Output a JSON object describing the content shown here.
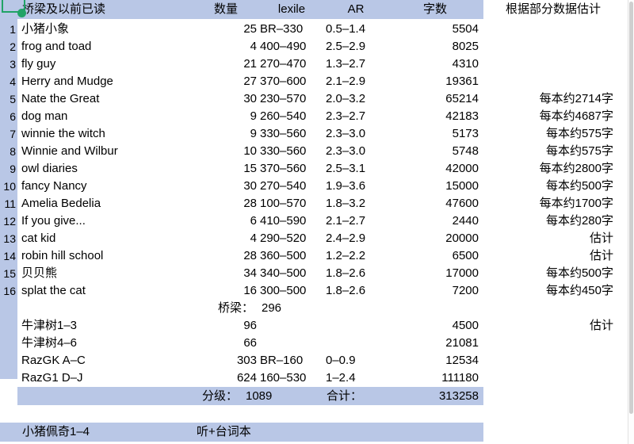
{
  "table": {
    "headers": {
      "gutter": "",
      "title": "桥梁及以前已读",
      "qty": "数量",
      "lexile": "lexile",
      "ar": "AR",
      "words": "字数",
      "note": "根据部分数据估计"
    },
    "rows": [
      {
        "num": "1",
        "title": "小猪小象",
        "qty": "25",
        "lexile": "BR–330",
        "ar": "0.5–1.4",
        "words": "5504",
        "note": ""
      },
      {
        "num": "2",
        "title": "frog and toad",
        "qty": "4",
        "lexile": "400–490",
        "ar": "2.5–2.9",
        "words": "8025",
        "note": ""
      },
      {
        "num": "3",
        "title": "fly guy",
        "qty": "21",
        "lexile": "270–470",
        "ar": "1.3–2.7",
        "words": "4310",
        "note": ""
      },
      {
        "num": "4",
        "title": "Herry and Mudge",
        "qty": "27",
        "lexile": "370–600",
        "ar": "2.1–2.9",
        "words": "19361",
        "note": ""
      },
      {
        "num": "5",
        "title": "Nate the Great",
        "qty": "30",
        "lexile": "230–570",
        "ar": "2.0–3.2",
        "words": "65214",
        "note": "每本约2714字"
      },
      {
        "num": "6",
        "title": "dog man",
        "qty": "9",
        "lexile": "260–540",
        "ar": "2.3–2.7",
        "words": "42183",
        "note": "每本约4687字"
      },
      {
        "num": "7",
        "title": "winnie the witch",
        "qty": "9",
        "lexile": "330–560",
        "ar": "2.3–3.0",
        "words": "5173",
        "note": "每本约575字"
      },
      {
        "num": "8",
        "title": "Winnie and Wilbur",
        "qty": "10",
        "lexile": "330–560",
        "ar": "2.3–3.0",
        "words": "5748",
        "note": "每本约575字"
      },
      {
        "num": "9",
        "title": "owl diaries",
        "qty": "15",
        "lexile": "370–560",
        "ar": "2.5–3.1",
        "words": "42000",
        "note": "每本约2800字"
      },
      {
        "num": "10",
        "title": "fancy Nancy",
        "qty": "30",
        "lexile": "270–540",
        "ar": "1.9–3.6",
        "words": "15000",
        "note": "每本约500字"
      },
      {
        "num": "11",
        "title": "Amelia Bedelia",
        "qty": "28",
        "lexile": "100–570",
        "ar": "1.8–3.2",
        "words": "47600",
        "note": "每本约1700字"
      },
      {
        "num": "12",
        "title": "If you give...",
        "qty": "6",
        "lexile": "410–590",
        "ar": "2.1–2.7",
        "words": "2440",
        "note": "每本约280字"
      },
      {
        "num": "13",
        "title": "cat kid",
        "qty": "4",
        "lexile": "290–520",
        "ar": "2.4–2.9",
        "words": "20000",
        "note": "估计"
      },
      {
        "num": "14",
        "title": "robin hill school",
        "qty": "28",
        "lexile": "360–500",
        "ar": "1.2–2.2",
        "words": "6500",
        "note": "估计"
      },
      {
        "num": "15",
        "title": "贝贝熊",
        "qty": "34",
        "lexile": "340–500",
        "ar": "1.8–2.6",
        "words": "17000",
        "note": "每本约500字"
      },
      {
        "num": "16",
        "title": "splat the cat",
        "qty": "16",
        "lexile": "300–500",
        "ar": "1.8–2.6",
        "words": "7200",
        "note": "每本约450字"
      }
    ],
    "subtotal": {
      "label": "桥梁：",
      "value": "296"
    },
    "extra_rows": [
      {
        "title": "牛津树1–3",
        "qty": "96",
        "lexile": "",
        "ar": "",
        "words": "4500",
        "note": "估计"
      },
      {
        "title": "牛津树4–6",
        "qty": "66",
        "lexile": "",
        "ar": "",
        "words": "21081",
        "note": ""
      },
      {
        "title": "RazGK A–C",
        "qty": "303",
        "lexile": "BR–160",
        "ar": "0–0.9",
        "words": "12534",
        "note": ""
      },
      {
        "title": "RazG1 D–J",
        "qty": "624",
        "lexile": "160–530",
        "ar": "1–2.4",
        "words": "111180",
        "note": ""
      }
    ],
    "total": {
      "grade_label": "分级：",
      "grade_value": "1089",
      "sum_label": "合计：",
      "sum_value": "313258"
    }
  },
  "bottom_row": {
    "title": "小猪佩奇1–4",
    "note": "听+台词本"
  },
  "colors": {
    "band": "#b9c7e6",
    "selection": "#21a366",
    "text": "#000000",
    "scrollbar": "#cfcfcf"
  }
}
